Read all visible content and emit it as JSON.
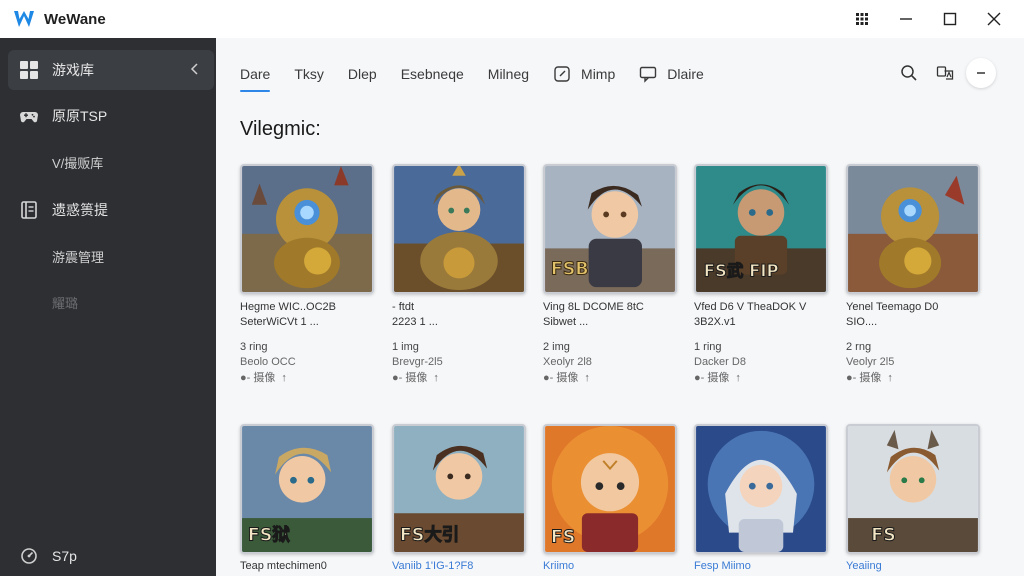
{
  "app": {
    "name": "WeWane",
    "brand_color": "#1e88e5"
  },
  "window": {
    "controls": [
      "apps-grid-icon",
      "minimize-icon",
      "maximize-icon",
      "close-icon"
    ]
  },
  "sidebar": {
    "bg": "#2d2f33",
    "items": [
      {
        "label": "游戏库",
        "icon": "grid-icon",
        "active": true
      },
      {
        "label": "原原TSP",
        "icon": "gamepad-icon"
      },
      {
        "label": "V/撮贩库",
        "sub": true
      },
      {
        "label": "遗惑篑提",
        "icon": "book-icon"
      },
      {
        "label": "游震管理",
        "sub": true
      },
      {
        "label": "耀璐",
        "sub": true,
        "dim": true
      }
    ],
    "footer": {
      "label": "S7p",
      "icon": "settings-icon"
    }
  },
  "tabs": [
    {
      "label": "Dare",
      "active": true
    },
    {
      "label": "Tksy"
    },
    {
      "label": "Dlep"
    },
    {
      "label": "Esebneqe"
    },
    {
      "label": "Milneg"
    },
    {
      "label": "Mimp",
      "icon": "edit-icon"
    },
    {
      "label": "Dlaire",
      "icon": "chat-icon"
    }
  ],
  "toolbar": {
    "icons": [
      "search-icon",
      "translate-icon",
      "more-icon"
    ]
  },
  "section": {
    "title": "Vilegmic:"
  },
  "games_row1": [
    {
      "title1": "Hegme WIC..OC2B",
      "title2": "SeterWiCVt 1 ...",
      "meta1": "3 ring",
      "meta2": "Beolo OCC",
      "action": "●- 摄像"
    },
    {
      "title1": "- ftdt",
      "title2": "2223 1 ...",
      "meta1": "1 img",
      "meta2": "Brevgr-2l5",
      "action": "●- 摄像"
    },
    {
      "title1": "Ving 8L DCOME 8tC",
      "title2": "Sibwet ...",
      "meta1": "2 img",
      "meta2": "Xeolyr 2l8",
      "action": "●- 摄像"
    },
    {
      "title1": "Vfed D6 V TheaDOK V",
      "title2": "3B2X.v1",
      "meta1": "1 ring",
      "meta2": "Dacker D8",
      "action": "●- 摄像"
    },
    {
      "title1": "Yenel Teemago D0",
      "title2": "SIO....",
      "meta1": "2 rng",
      "meta2": "Veolyr 2l5",
      "action": "●- 摄像"
    }
  ],
  "games_row2": [
    {
      "name": "Teap mtechimen0",
      "banner": "FS狱",
      "link": false
    },
    {
      "name": "Vaniib 1'IG-1?F8",
      "banner": "FS大引",
      "link": true
    },
    {
      "name": "Kriimo",
      "banner": "FS",
      "link": true
    },
    {
      "name": "Fesp Miimo",
      "banner": "",
      "link": true
    },
    {
      "name": "Yeaiing",
      "banner": "FS",
      "link": true
    }
  ],
  "row1_banners": [
    "",
    "",
    "FSB",
    "FS武 FIP",
    ""
  ]
}
